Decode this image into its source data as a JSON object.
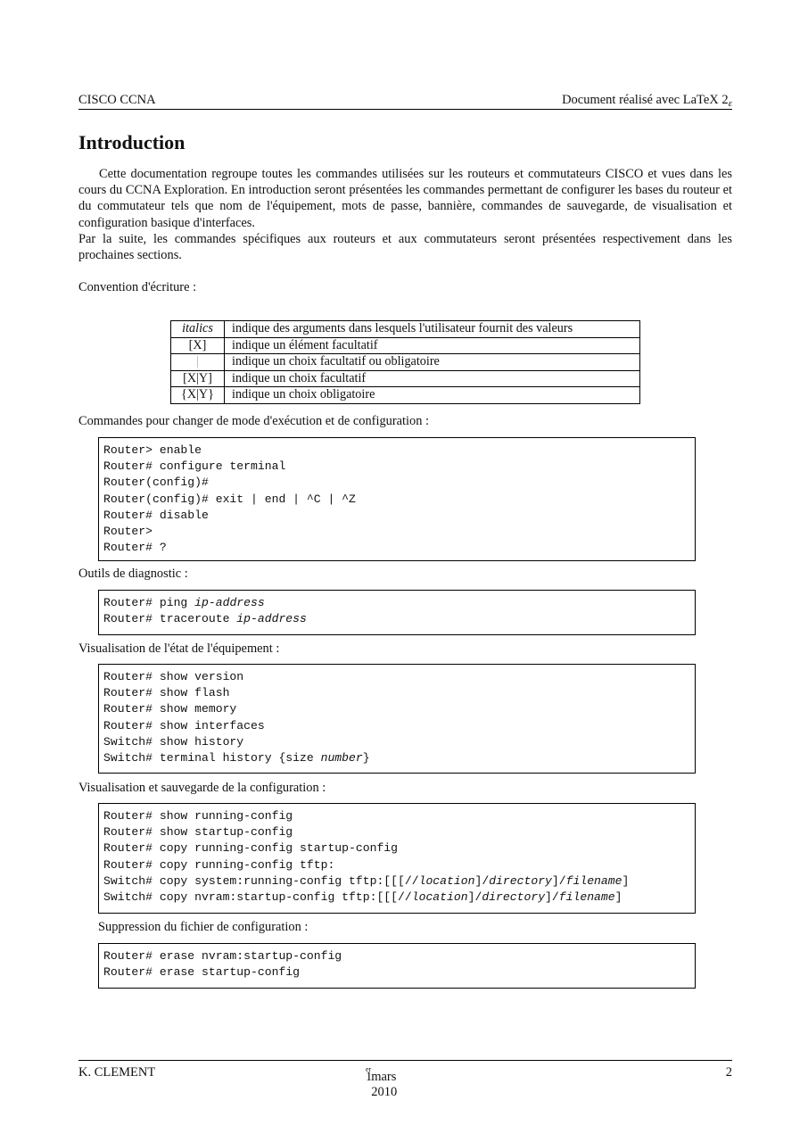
{
  "header": {
    "left": "CISCO CCNA",
    "right_prefix": "Document réalisé avec ",
    "right_logo": "LaTeX 2",
    "right_logo_sub": "ε"
  },
  "title": "Introduction",
  "intro": {
    "paragraph_1": "Cette documentation regroupe toutes les commandes utilisées sur les routeurs et commutateurs CISCO et vues dans les cours du CCNA Exploration. En introduction seront présentées les commandes permettant de configurer les bases du routeur et du commutateur tels que nom de l'équipement, mots de passe, bannière, commandes de sauvegarde, de visualisation et configuration basique d'interfaces.",
    "paragraph_2": "Par la suite, les commandes spécifiques aux routeurs et aux commutateurs seront présentées respectivement dans les prochaines sections."
  },
  "convention": {
    "label": "Convention d'écriture :",
    "rows": [
      {
        "symbol": "italics",
        "description": "indique des arguments dans lesquels l'utilisateur fournit des valeurs"
      },
      {
        "symbol": "[X]",
        "description": "indique un élément facultatif"
      },
      {
        "symbol": "|",
        "description": "indique un choix facultatif ou obligatoire"
      },
      {
        "symbol": "[X|Y]",
        "description": "indique un choix facultatif"
      },
      {
        "symbol": "{X|Y}",
        "description": "indique un choix obligatoire"
      }
    ]
  },
  "sections": [
    {
      "label": "Commandes pour changer de mode d'exécution et de configuration :",
      "lines": [
        [
          {
            "t": "Router> enable"
          }
        ],
        [
          {
            "t": "Router# configure terminal"
          }
        ],
        [
          {
            "t": "Router(config)#"
          }
        ],
        [
          {
            "t": "Router(config)# exit | end | ^C | ^Z"
          }
        ],
        [
          {
            "t": "Router# disable"
          }
        ],
        [
          {
            "t": "Router>"
          }
        ],
        [
          {
            "t": "Router# ?"
          }
        ]
      ]
    },
    {
      "label": "Outils de diagnostic :",
      "lines": [
        [
          {
            "t": "Router# ping "
          },
          {
            "t": "ip-address",
            "i": true
          }
        ],
        [
          {
            "t": "Router# traceroute "
          },
          {
            "t": "ip-address",
            "i": true
          }
        ]
      ]
    },
    {
      "label": "Visualisation de l'état de l'équipement :",
      "lines": [
        [
          {
            "t": "Router# show version"
          }
        ],
        [
          {
            "t": "Router# show flash"
          }
        ],
        [
          {
            "t": "Router# show memory"
          }
        ],
        [
          {
            "t": "Router# show interfaces"
          }
        ],
        [
          {
            "t": "Switch# show history"
          }
        ],
        [
          {
            "t": "Switch# terminal history {size "
          },
          {
            "t": "number",
            "i": true
          },
          {
            "t": "}"
          }
        ]
      ]
    },
    {
      "label": "Visualisation et sauvegarde de la configuration :",
      "lines": [
        [
          {
            "t": "Router# show running-config"
          }
        ],
        [
          {
            "t": "Router# show startup-config"
          }
        ],
        [
          {
            "t": "Router# copy running-config startup-config"
          }
        ],
        [
          {
            "t": "Router# copy running-config tftp:"
          }
        ],
        [
          {
            "t": "Switch# copy system:running-config tftp:[[[//"
          },
          {
            "t": "location",
            "i": true
          },
          {
            "t": "]/"
          },
          {
            "t": "directory",
            "i": true
          },
          {
            "t": "]/"
          },
          {
            "t": "filename",
            "i": true
          },
          {
            "t": "]"
          }
        ],
        [
          {
            "t": "Switch# copy nvram:startup-config tftp:[[[//"
          },
          {
            "t": "location",
            "i": true
          },
          {
            "t": "]/"
          },
          {
            "t": "directory",
            "i": true
          },
          {
            "t": "]/"
          },
          {
            "t": "filename",
            "i": true
          },
          {
            "t": "]"
          }
        ]
      ]
    },
    {
      "label": "Suppression du fichier de configuration :",
      "lines": [
        [
          {
            "t": "Router# erase nvram:startup-config"
          }
        ],
        [
          {
            "t": "Router# erase startup-config"
          }
        ]
      ]
    }
  ],
  "footer": {
    "author": "K. CLEMENT",
    "date_day": "1",
    "date_sup": "er",
    "date_rest": " mars 2010",
    "page_number": "2"
  }
}
